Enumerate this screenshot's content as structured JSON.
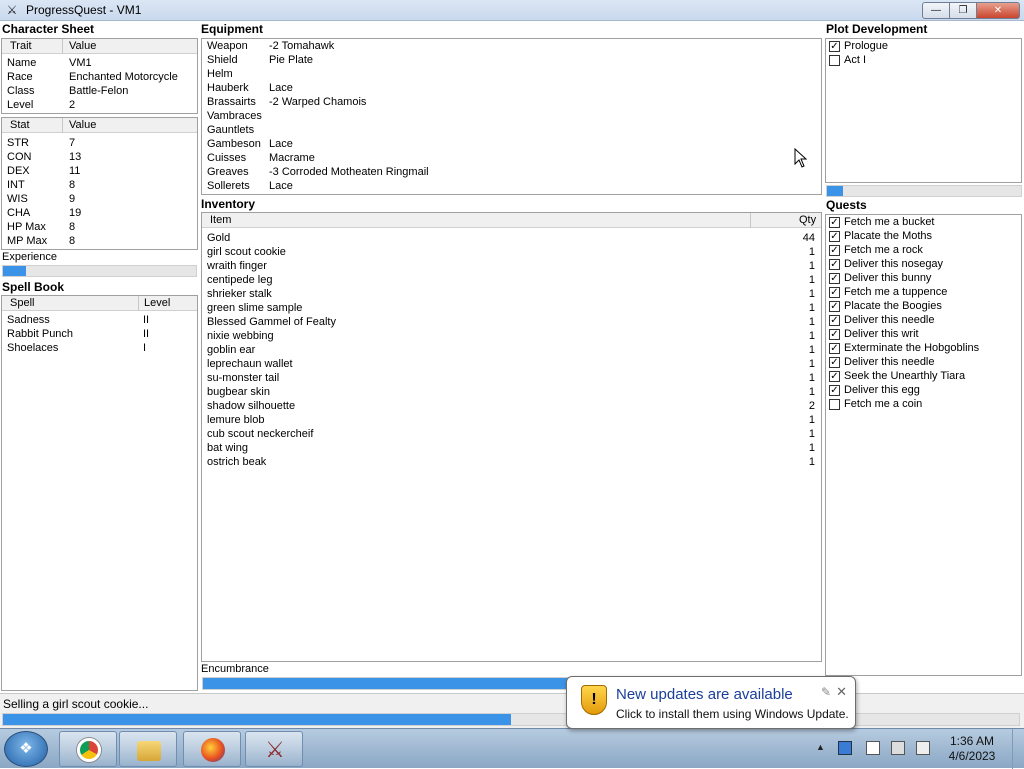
{
  "window": {
    "title": "ProgressQuest - VM1",
    "min": "—",
    "max": "❐",
    "close": "✕"
  },
  "character": {
    "title": "Character Sheet",
    "trait_hdr": "Trait",
    "value_hdr": "Value",
    "traits": [
      {
        "k": "Name",
        "v": "VM1"
      },
      {
        "k": "Race",
        "v": "Enchanted Motorcycle"
      },
      {
        "k": "Class",
        "v": "Battle-Felon"
      },
      {
        "k": "Level",
        "v": "2"
      }
    ],
    "stat_hdr": "Stat",
    "stat_value_hdr": "Value",
    "stats": [
      {
        "k": "STR",
        "v": "7"
      },
      {
        "k": "CON",
        "v": "13"
      },
      {
        "k": "DEX",
        "v": "11"
      },
      {
        "k": "INT",
        "v": "8"
      },
      {
        "k": "WIS",
        "v": "9"
      },
      {
        "k": "CHA",
        "v": "19"
      },
      {
        "k": "HP Max",
        "v": "8"
      },
      {
        "k": "MP Max",
        "v": "8"
      }
    ],
    "experience_label": "Experience",
    "experience_progress": 0.12
  },
  "spellbook": {
    "title": "Spell Book",
    "spell_hdr": "Spell",
    "level_hdr": "Level",
    "spells": [
      {
        "k": "Sadness",
        "v": "II"
      },
      {
        "k": "Rabbit Punch",
        "v": "II"
      },
      {
        "k": "Shoelaces",
        "v": "I"
      }
    ]
  },
  "equipment": {
    "title": "Equipment",
    "items": [
      {
        "k": "Weapon",
        "v": "-2 Tomahawk"
      },
      {
        "k": "Shield",
        "v": "Pie Plate"
      },
      {
        "k": "Helm",
        "v": ""
      },
      {
        "k": "Hauberk",
        "v": "Lace"
      },
      {
        "k": "Brassairts",
        "v": "-2 Warped Chamois"
      },
      {
        "k": "Vambraces",
        "v": ""
      },
      {
        "k": "Gauntlets",
        "v": ""
      },
      {
        "k": "Gambeson",
        "v": "Lace"
      },
      {
        "k": "Cuisses",
        "v": "Macrame"
      },
      {
        "k": "Greaves",
        "v": "-3 Corroded Motheaten Ringmail"
      },
      {
        "k": "Sollerets",
        "v": "Lace"
      }
    ]
  },
  "inventory": {
    "title": "Inventory",
    "item_hdr": "Item",
    "qty_hdr": "Qty",
    "items": [
      {
        "k": "Gold",
        "v": "44"
      },
      {
        "k": "girl scout cookie",
        "v": "1"
      },
      {
        "k": "wraith finger",
        "v": "1"
      },
      {
        "k": "centipede leg",
        "v": "1"
      },
      {
        "k": "shrieker stalk",
        "v": "1"
      },
      {
        "k": "green slime sample",
        "v": "1"
      },
      {
        "k": "Blessed Gammel of Fealty",
        "v": "1"
      },
      {
        "k": "nixie webbing",
        "v": "1"
      },
      {
        "k": "goblin ear",
        "v": "1"
      },
      {
        "k": "leprechaun wallet",
        "v": "1"
      },
      {
        "k": "su-monster tail",
        "v": "1"
      },
      {
        "k": "bugbear skin",
        "v": "1"
      },
      {
        "k": "shadow silhouette",
        "v": "2"
      },
      {
        "k": "lemure blob",
        "v": "1"
      },
      {
        "k": "cub scout neckercheif",
        "v": "1"
      },
      {
        "k": "bat wing",
        "v": "1"
      },
      {
        "k": "ostrich beak",
        "v": "1"
      }
    ],
    "encumbrance_label": "Encumbrance",
    "encumbrance_progress": 0.9
  },
  "plot": {
    "title": "Plot Development",
    "items": [
      {
        "label": "Prologue",
        "checked": true
      },
      {
        "label": "Act I",
        "checked": false
      }
    ],
    "progress": 0.08
  },
  "quests": {
    "title": "Quests",
    "items": [
      {
        "label": "Fetch me a bucket",
        "checked": true
      },
      {
        "label": "Placate the Moths",
        "checked": true
      },
      {
        "label": "Fetch me a rock",
        "checked": true
      },
      {
        "label": "Deliver this nosegay",
        "checked": true
      },
      {
        "label": "Deliver this bunny",
        "checked": true
      },
      {
        "label": "Fetch me a tuppence",
        "checked": true
      },
      {
        "label": "Placate the Boogies",
        "checked": true
      },
      {
        "label": "Deliver this needle",
        "checked": true
      },
      {
        "label": "Deliver this writ",
        "checked": true
      },
      {
        "label": "Exterminate the Hobgoblins",
        "checked": true
      },
      {
        "label": "Deliver this needle",
        "checked": true
      },
      {
        "label": "Seek the Unearthly Tiara",
        "checked": true
      },
      {
        "label": "Deliver this egg",
        "checked": true
      },
      {
        "label": "Fetch me a coin",
        "checked": false
      }
    ]
  },
  "status": {
    "text": "Selling a girl scout cookie...",
    "progress": 0.5
  },
  "toast": {
    "title": "New updates are available",
    "body": "Click to install them using Windows Update.",
    "close": "✕"
  },
  "taskbar": {
    "time": "1:36 AM",
    "date": "4/6/2023"
  },
  "colors": {
    "accent": "#3a93e6",
    "titlebar": "#c9d9ee"
  }
}
